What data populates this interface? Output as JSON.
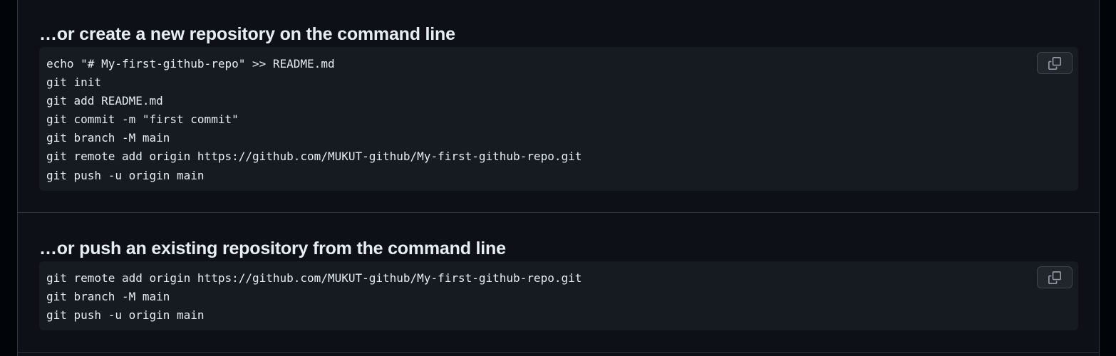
{
  "sections": [
    {
      "heading": "…or create a new repository on the command line",
      "lines": [
        "echo \"# My-first-github-repo\" >> README.md",
        "git init",
        "git add README.md",
        "git commit -m \"first commit\"",
        "git branch -M main",
        "git remote add origin https://github.com/MUKUT-github/My-first-github-repo.git",
        "git push -u origin main"
      ],
      "copy_icon": "copy-icon"
    },
    {
      "heading": "…or push an existing repository from the command line",
      "lines": [
        "git remote add origin https://github.com/MUKUT-github/My-first-github-repo.git",
        "git branch -M main",
        "git push -u origin main"
      ],
      "copy_icon": "copy-icon"
    }
  ],
  "colors": {
    "page_background": "#010409",
    "panel_background": "#0d1117",
    "code_background": "#161b22",
    "text": "#e6edf3",
    "border": "#30363d",
    "button_background": "#21262d",
    "icon": "#9198a1"
  }
}
